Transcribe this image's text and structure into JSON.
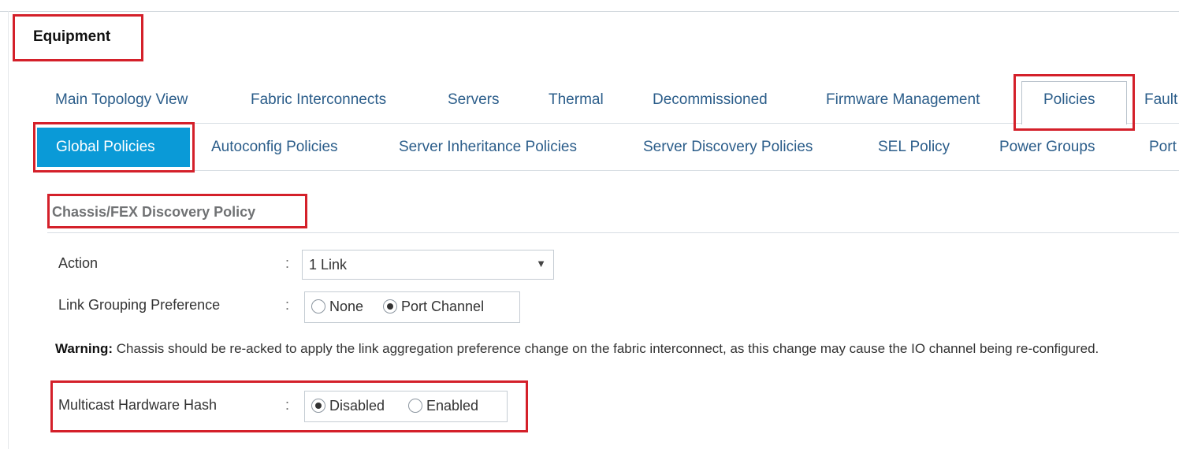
{
  "header": {
    "title": "Equipment"
  },
  "tabs_primary": [
    {
      "label": "Main Topology View"
    },
    {
      "label": "Fabric Interconnects"
    },
    {
      "label": "Servers"
    },
    {
      "label": "Thermal"
    },
    {
      "label": "Decommissioned"
    },
    {
      "label": "Firmware Management"
    },
    {
      "label": "Policies",
      "active": true
    },
    {
      "label": "Fault"
    }
  ],
  "tabs_secondary": [
    {
      "label": "Global Policies",
      "active": true
    },
    {
      "label": "Autoconfig Policies"
    },
    {
      "label": "Server Inheritance Policies"
    },
    {
      "label": "Server Discovery Policies"
    },
    {
      "label": "SEL Policy"
    },
    {
      "label": "Power Groups"
    },
    {
      "label": "Port"
    }
  ],
  "section": {
    "title": "Chassis/FEX Discovery Policy"
  },
  "form": {
    "colon": ":",
    "action": {
      "label": "Action",
      "value": "1 Link"
    },
    "link_grouping": {
      "label": "Link Grouping Preference",
      "options": [
        {
          "label": "None",
          "selected": false
        },
        {
          "label": "Port Channel",
          "selected": true
        }
      ]
    },
    "warning": {
      "prefix": "Warning:",
      "text": "Chassis should be re-acked to apply the link aggregation preference change on the fabric interconnect, as this change may cause the IO channel being re-configured."
    },
    "multicast_hash": {
      "label": "Multicast Hardware Hash",
      "options": [
        {
          "label": "Disabled",
          "selected": true
        },
        {
          "label": "Enabled",
          "selected": false
        }
      ]
    }
  },
  "colors": {
    "accent": "#0a9ad7",
    "link": "#2b5d8a",
    "highlight": "#d4202a"
  }
}
